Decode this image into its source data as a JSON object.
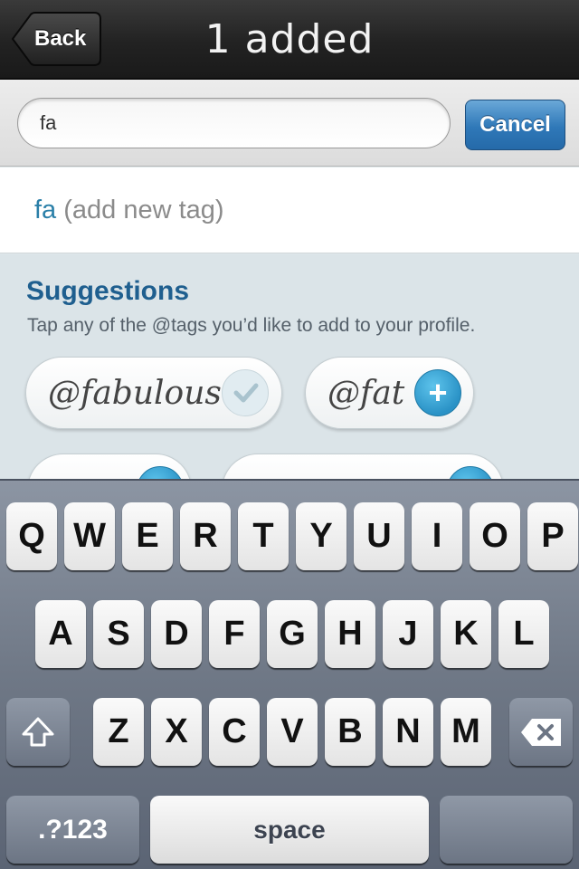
{
  "nav": {
    "back_label": "Back",
    "title": "1 added"
  },
  "search": {
    "value": "fa",
    "cancel_label": "Cancel"
  },
  "result": {
    "query": "fa",
    "hint": " (add new tag)"
  },
  "suggestions": {
    "title": "Suggestions",
    "subtitle": "Tap any of the @tags you’d like to add to your profile.",
    "tags": [
      {
        "label": "@fabulous",
        "state": "added",
        "icon": "check-icon"
      },
      {
        "label": "@fat",
        "state": "available",
        "icon": "plus-icon"
      }
    ]
  },
  "keyboard": {
    "row1": [
      "Q",
      "W",
      "E",
      "R",
      "T",
      "Y",
      "U",
      "I",
      "O",
      "P"
    ],
    "row2": [
      "A",
      "S",
      "D",
      "F",
      "G",
      "H",
      "J",
      "K",
      "L"
    ],
    "row3": [
      "Z",
      "X",
      "C",
      "V",
      "B",
      "N",
      "M"
    ],
    "shift_icon": "shift-icon",
    "delete_icon": "backspace-icon",
    "numbers_label": ".?123",
    "space_label": "space"
  },
  "colors": {
    "accent": "#2a7fa8",
    "title_blue": "#1f5f8f",
    "cancel_blue": "#2f78b8",
    "plus_blue": "#2a92c6"
  }
}
